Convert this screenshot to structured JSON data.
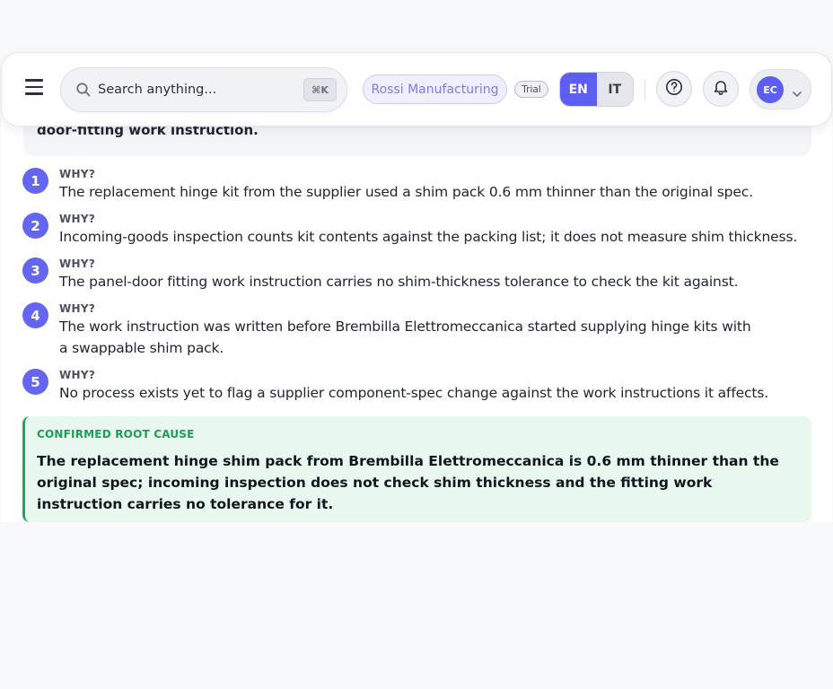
{
  "previous_text": "door-fitting work instruction.",
  "header": {
    "search_placeholder": "Search anything...",
    "search_shortcut": "⌘K",
    "organization": "Rossi Manufacturing",
    "plan_badge": "Trial",
    "languages": [
      {
        "code": "EN",
        "active": true
      },
      {
        "code": "IT",
        "active": false
      }
    ],
    "user_initials": "EC"
  },
  "whys": [
    {
      "number": "1",
      "label": "WHY?",
      "text": "The replacement hinge kit from the supplier used a shim pack 0.6 mm thinner than the original spec."
    },
    {
      "number": "2",
      "label": "WHY?",
      "text": "Incoming-goods inspection counts kit contents against the packing list; it does not measure shim thickness."
    },
    {
      "number": "3",
      "label": "WHY?",
      "text": "The panel-door fitting work instruction carries no shim-thickness tolerance to check the kit against."
    },
    {
      "number": "4",
      "label": "WHY?",
      "text": "The work instruction was written before Brembilla Elettromeccanica started supplying hinge kits with a swappable shim pack."
    },
    {
      "number": "5",
      "label": "WHY?",
      "text": "No process exists yet to flag a supplier component-spec change against the work instructions it affects."
    }
  ],
  "root_cause": {
    "label": "CONFIRMED ROOT CAUSE",
    "text": "The replacement hinge shim pack from Brembilla Elettromeccanica is 0.6 mm thinner than the original spec; incoming inspection does not check shim thickness and the fitting work instruction carries no tolerance for it."
  },
  "colors": {
    "accent": "#5b5ef0",
    "step_badge": "#6366f1",
    "root_cause_bg": "#e8f8ee",
    "root_cause_accent": "#22a45d"
  },
  "icons": [
    "menu-icon",
    "search-icon",
    "help-icon",
    "bell-icon",
    "chevron-down-icon"
  ]
}
